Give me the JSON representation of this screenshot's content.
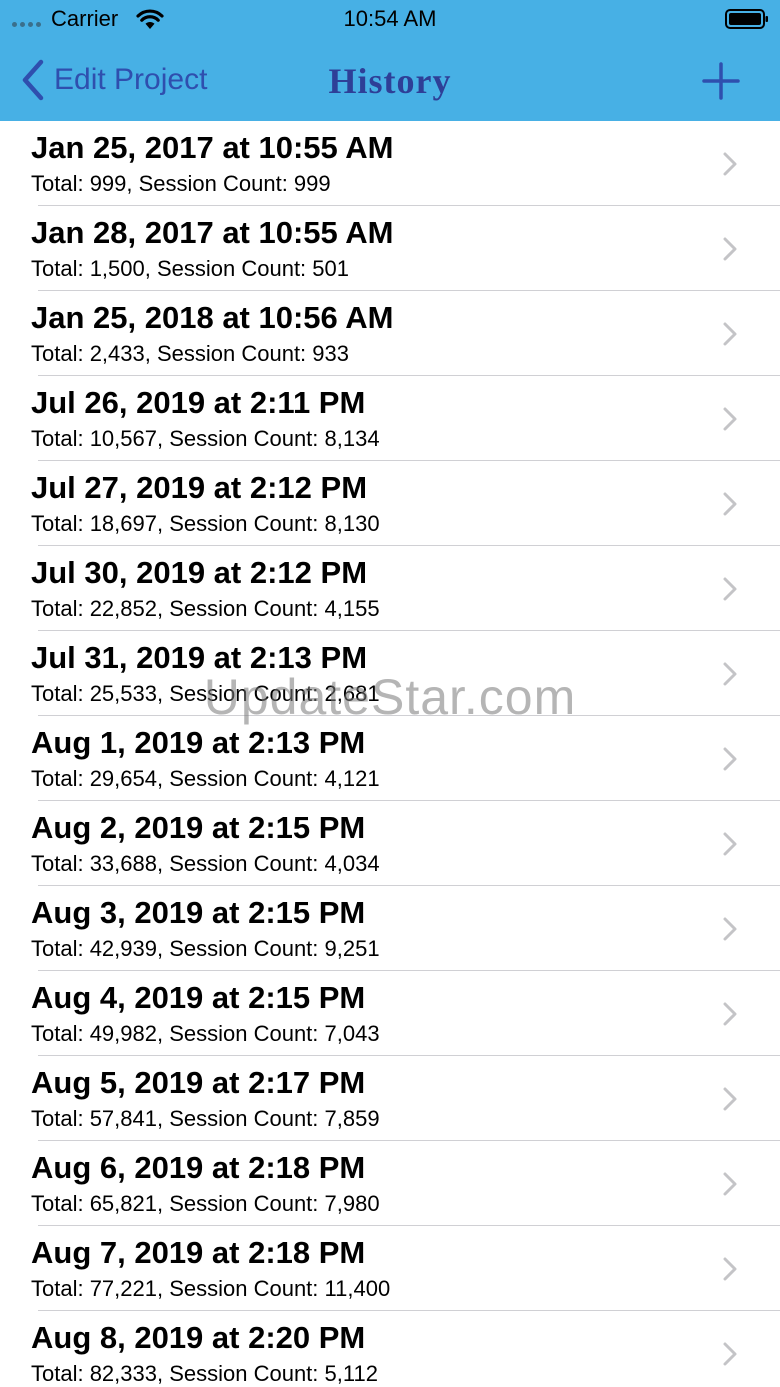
{
  "status_bar": {
    "carrier": "Carrier",
    "time": "10:54 AM"
  },
  "nav": {
    "back_label": "Edit Project",
    "title": "History",
    "add_icon": "plus-icon",
    "back_icon": "chevron-left-icon",
    "accent_color": "#47b0e5",
    "tint_color": "#2f4fae"
  },
  "history": [
    {
      "title": "Jan 25, 2017 at 10:55 AM",
      "subtitle": "Total: 999, Session Count: 999"
    },
    {
      "title": "Jan 28, 2017 at 10:55 AM",
      "subtitle": "Total: 1,500, Session Count: 501"
    },
    {
      "title": "Jan 25, 2018 at 10:56 AM",
      "subtitle": "Total: 2,433, Session Count: 933"
    },
    {
      "title": "Jul 26, 2019 at 2:11 PM",
      "subtitle": "Total: 10,567, Session Count: 8,134"
    },
    {
      "title": "Jul 27, 2019 at 2:12 PM",
      "subtitle": "Total: 18,697, Session Count: 8,130"
    },
    {
      "title": "Jul 30, 2019 at 2:12 PM",
      "subtitle": "Total: 22,852, Session Count: 4,155"
    },
    {
      "title": "Jul 31, 2019 at 2:13 PM",
      "subtitle": "Total: 25,533, Session Count: 2,681"
    },
    {
      "title": "Aug 1, 2019 at 2:13 PM",
      "subtitle": "Total: 29,654, Session Count: 4,121"
    },
    {
      "title": "Aug 2, 2019 at 2:15 PM",
      "subtitle": "Total: 33,688, Session Count: 4,034"
    },
    {
      "title": "Aug 3, 2019 at 2:15 PM",
      "subtitle": "Total: 42,939, Session Count: 9,251"
    },
    {
      "title": "Aug 4, 2019 at 2:15 PM",
      "subtitle": "Total: 49,982, Session Count: 7,043"
    },
    {
      "title": "Aug 5, 2019 at 2:17 PM",
      "subtitle": "Total: 57,841, Session Count: 7,859"
    },
    {
      "title": "Aug 6, 2019 at 2:18 PM",
      "subtitle": "Total: 65,821, Session Count: 7,980"
    },
    {
      "title": "Aug 7, 2019 at 2:18 PM",
      "subtitle": "Total: 77,221, Session Count: 11,400"
    },
    {
      "title": "Aug 8, 2019 at 2:20 PM",
      "subtitle": "Total: 82,333, Session Count: 5,112"
    }
  ],
  "row_icon": "chevron-right-icon",
  "watermark": "UpdateStar.com"
}
